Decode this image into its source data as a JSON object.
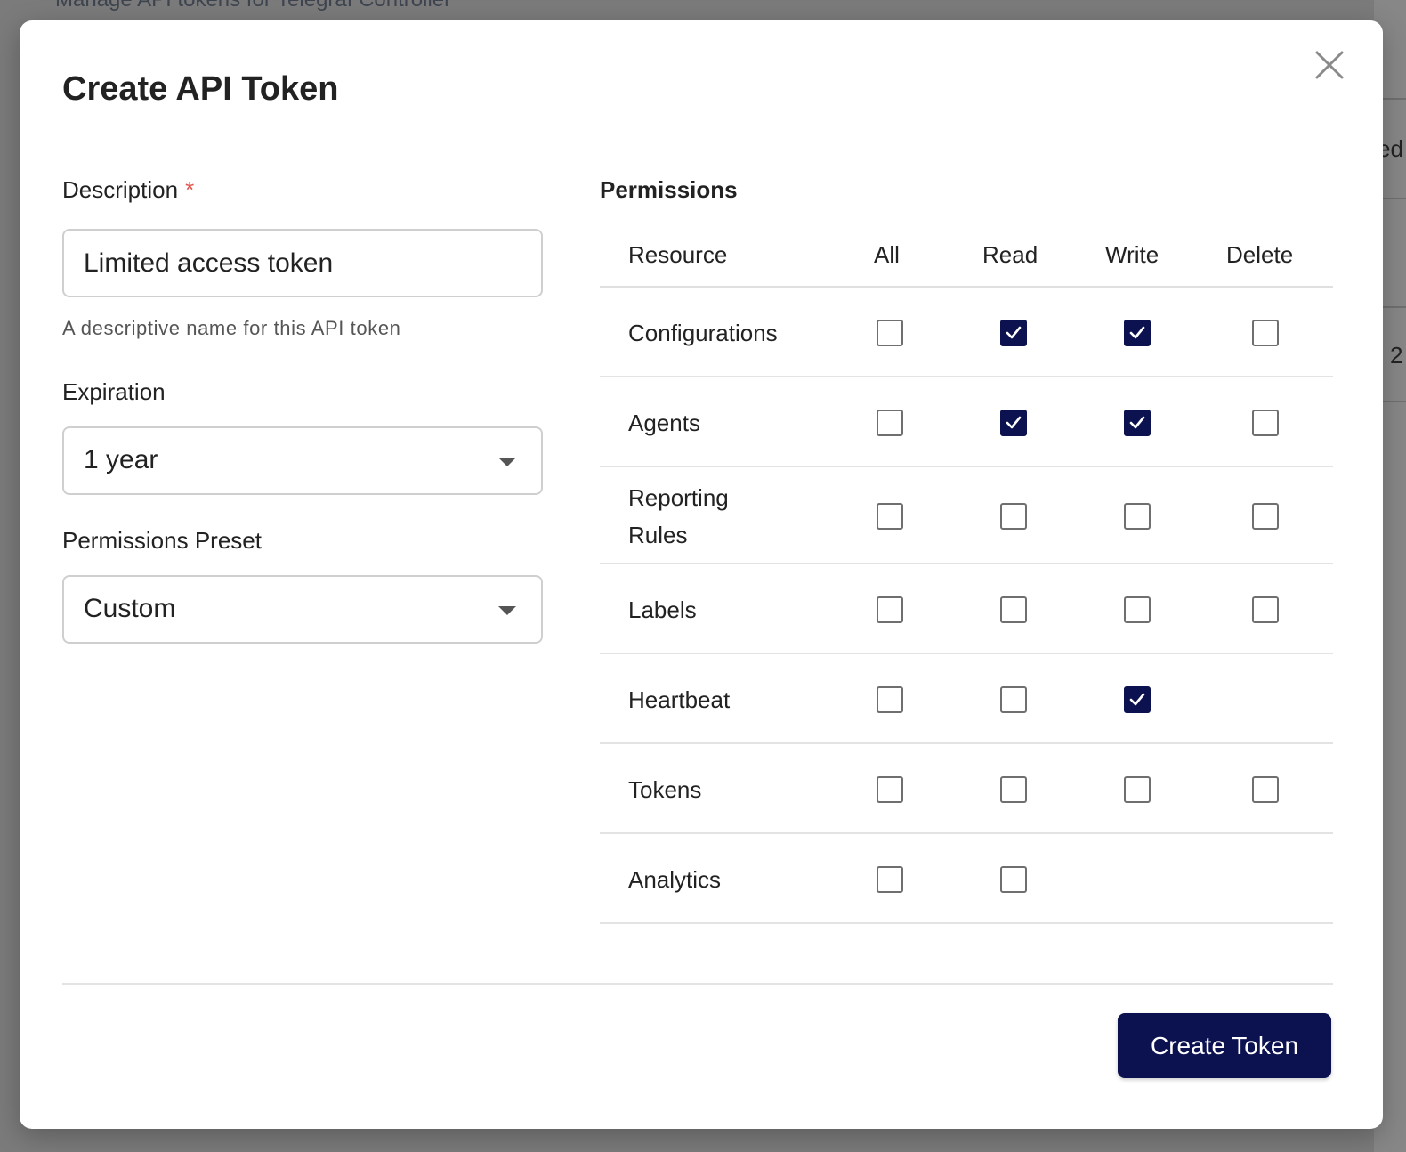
{
  "backdrop": {
    "subtitle": "Manage API tokens for Telegraf Controller",
    "right_fragment_1": "ed",
    "right_fragment_2": "2"
  },
  "modal": {
    "title": "Create API Token",
    "close_icon": "close-icon"
  },
  "form": {
    "description": {
      "label": "Description",
      "required_mark": "*",
      "value": "Limited access token",
      "help": "A descriptive name for this API token"
    },
    "expiration": {
      "label": "Expiration",
      "selected": "1 year"
    },
    "preset": {
      "label": "Permissions Preset",
      "selected": "Custom"
    }
  },
  "permissions": {
    "title": "Permissions",
    "columns": {
      "resource": "Resource",
      "all": "All",
      "read": "Read",
      "write": "Write",
      "delete": "Delete"
    },
    "rows": [
      {
        "resource": "Configurations",
        "all": false,
        "read": true,
        "write": true,
        "delete": false
      },
      {
        "resource": "Agents",
        "all": false,
        "read": true,
        "write": true,
        "delete": false
      },
      {
        "resource": "Reporting Rules",
        "all": false,
        "read": false,
        "write": false,
        "delete": false
      },
      {
        "resource": "Labels",
        "all": false,
        "read": false,
        "write": false,
        "delete": false
      },
      {
        "resource": "Heartbeat",
        "all": false,
        "read": false,
        "write": true,
        "delete": null
      },
      {
        "resource": "Tokens",
        "all": false,
        "read": false,
        "write": false,
        "delete": false
      },
      {
        "resource": "Analytics",
        "all": false,
        "read": false,
        "write": null,
        "delete": null
      }
    ]
  },
  "footer": {
    "create_label": "Create Token"
  },
  "colors": {
    "primary": "#0c1150",
    "required": "#e0564f",
    "border": "#cfcfcf"
  }
}
